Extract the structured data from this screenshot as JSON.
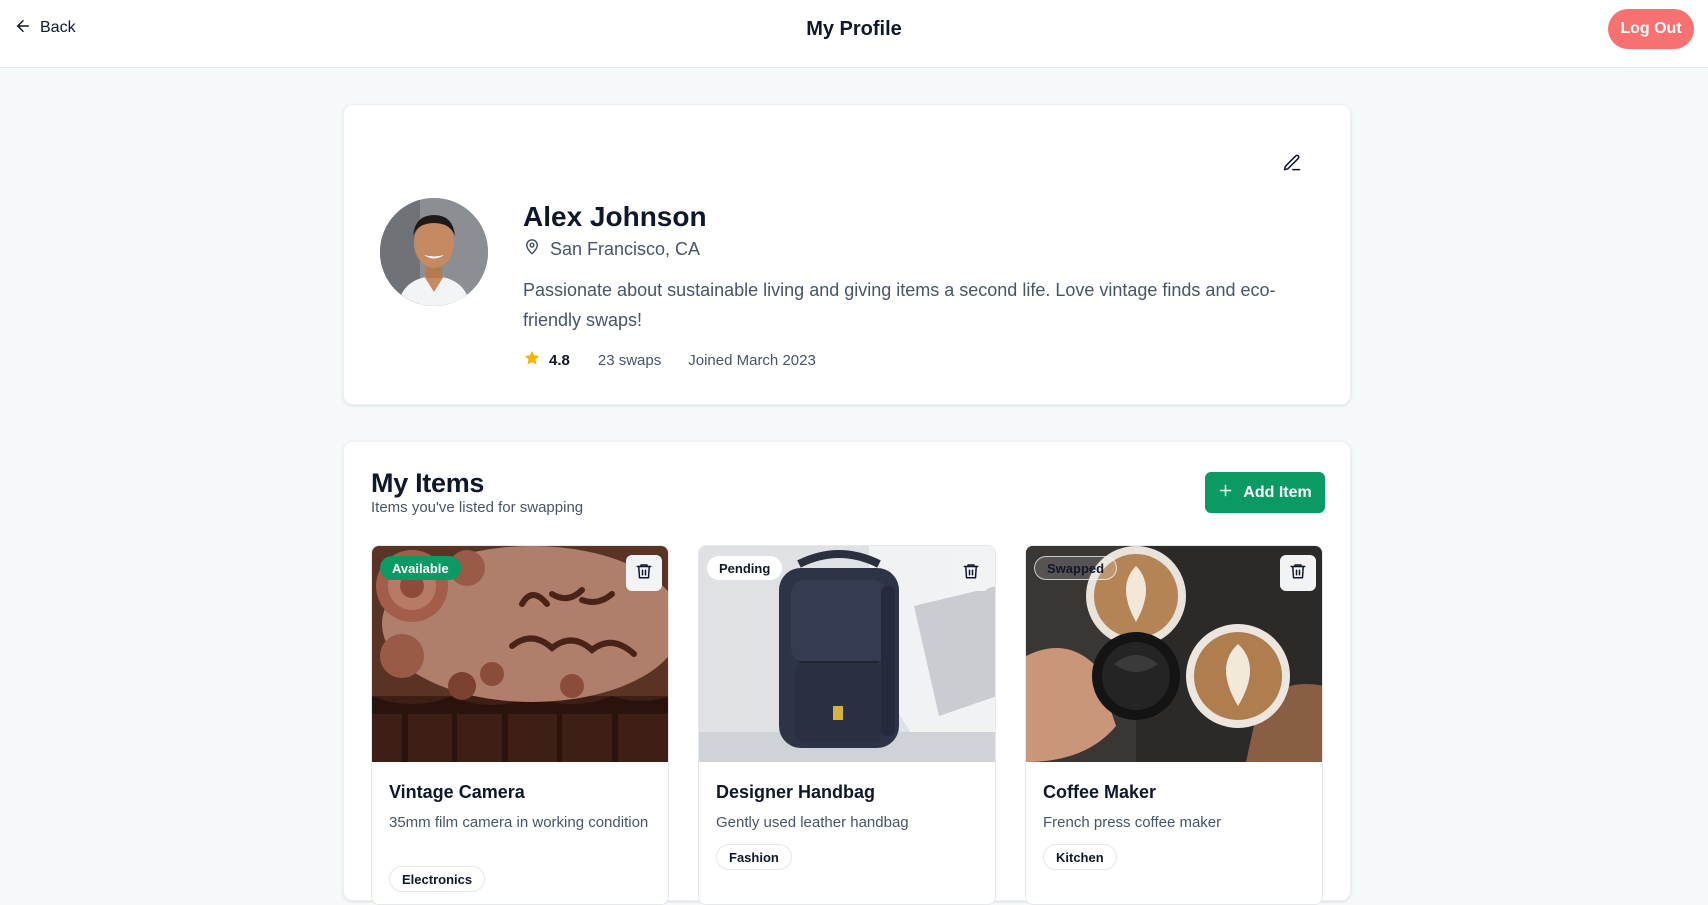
{
  "header": {
    "back_label": "Back",
    "title": "My Profile",
    "logout_label": "Log Out",
    "logout_color": "#f87171"
  },
  "profile": {
    "name": "Alex Johnson",
    "location": "San Francisco, CA",
    "bio": "Passionate about sustainable living and giving items a second life. Love vintage finds and eco-friendly swaps!",
    "rating": "4.8",
    "swaps": "23 swaps",
    "joined": "Joined March 2023",
    "icons": [
      "edit-pencil-icon",
      "map-pin-icon",
      "star-icon"
    ]
  },
  "items_section": {
    "title": "My Items",
    "subtitle": "Items you've listed for swapping",
    "add_label": "Add Item",
    "accent_color": "#0b9a63",
    "items": [
      {
        "name": "Vintage Camera",
        "description": "35mm film camera in working condition",
        "tag": "Electronics",
        "status": "Available",
        "image": "birthday-cake-photo"
      },
      {
        "name": "Designer Handbag",
        "description": "Gently used leather handbag",
        "tag": "Fashion",
        "status": "Pending",
        "image": "backpack-photo"
      },
      {
        "name": "Coffee Maker",
        "description": "French press coffee maker",
        "tag": "Kitchen",
        "status": "Swapped",
        "image": "coffee-cups-photo"
      }
    ]
  }
}
